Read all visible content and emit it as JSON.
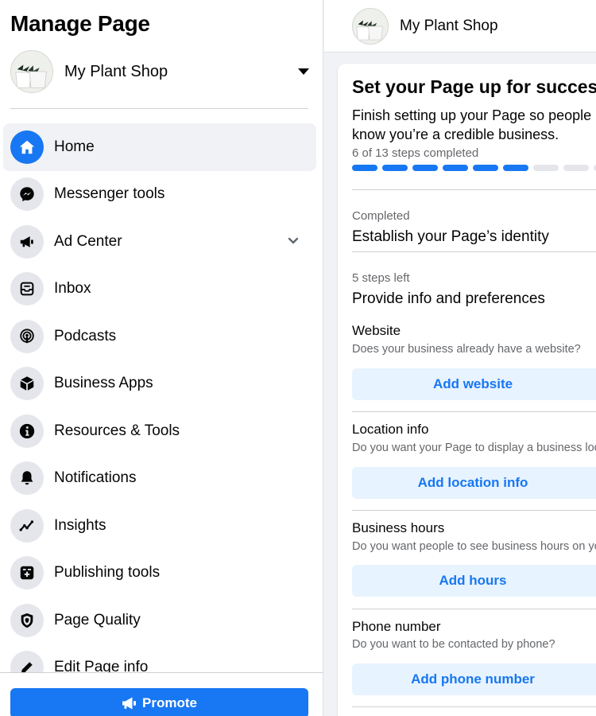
{
  "sidebar": {
    "title": "Manage Page",
    "page_name": "My Plant Shop",
    "items": [
      {
        "label": "Home",
        "icon": "home-icon"
      },
      {
        "label": "Messenger tools",
        "icon": "messenger-icon"
      },
      {
        "label": "Ad Center",
        "icon": "megaphone-icon"
      },
      {
        "label": "Inbox",
        "icon": "inbox-icon"
      },
      {
        "label": "Podcasts",
        "icon": "podcast-icon"
      },
      {
        "label": "Business Apps",
        "icon": "cube-icon"
      },
      {
        "label": "Resources & Tools",
        "icon": "info-icon"
      },
      {
        "label": "Notifications",
        "icon": "bell-icon"
      },
      {
        "label": "Insights",
        "icon": "trend-icon"
      },
      {
        "label": "Publishing tools",
        "icon": "publishing-icon"
      },
      {
        "label": "Page Quality",
        "icon": "shield-icon"
      },
      {
        "label": "Edit Page info",
        "icon": "pencil-icon"
      }
    ],
    "promote_label": "Promote"
  },
  "topbar": {
    "page_name": "My Plant Shop"
  },
  "setup": {
    "title": "Set your Page up for success",
    "subtitle": "Finish setting up your Page so people know you’re a credible business.",
    "steps_text": "6 of 13 steps completed",
    "steps_done": 6,
    "steps_total": 13,
    "completed_kicker": "Completed",
    "completed_heading": "Establish your Page’s identity",
    "remaining_kicker": "5 steps left",
    "remaining_heading": "Provide info and preferences",
    "tasks": [
      {
        "title": "Website",
        "desc": "Does your business already have a website?",
        "button": "Add website"
      },
      {
        "title": "Location info",
        "desc": "Do you want your Page to display a business location?",
        "button": "Add location info"
      },
      {
        "title": "Business hours",
        "desc": "Do you want people to see business hours on your Page?",
        "button": "Add hours"
      },
      {
        "title": "Phone number",
        "desc": "Do you want to be contacted by phone?",
        "button": "Add phone number"
      }
    ]
  },
  "colors": {
    "accent": "#1877f2",
    "accent_light": "#e7f3ff",
    "background": "#f0f2f5",
    "secondary_text": "#65676b"
  }
}
